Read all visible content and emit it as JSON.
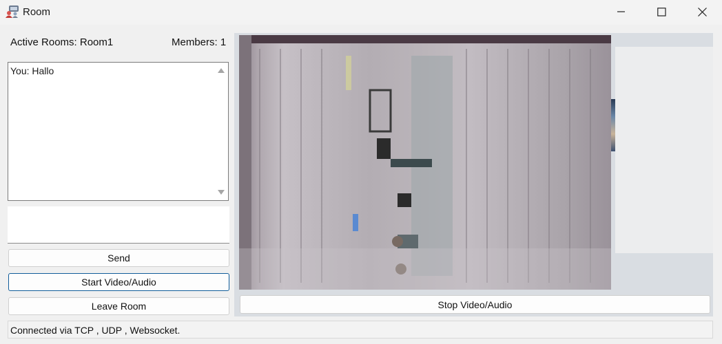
{
  "window": {
    "title": "Room",
    "icon": "chat-app-icon",
    "controls": [
      "minimize-icon",
      "maximize-icon",
      "close-icon"
    ]
  },
  "header": {
    "active_rooms": "Active Rooms: Room1",
    "members": "Members: 1"
  },
  "chat": {
    "messages": [
      "You: Hallo"
    ]
  },
  "message_input": {
    "value": "",
    "placeholder": ""
  },
  "buttons": {
    "send": "Send",
    "start_video": "Start Video/Audio",
    "leave_room": "Leave Room",
    "stop_video": "Stop Video/Audio"
  },
  "video": {
    "feed": "local-camera-feed"
  },
  "status": "Connected via TCP , UDP , Websocket.",
  "colors": {
    "focus_border": "#0f5c99",
    "window_bg": "#f0f0f0"
  }
}
